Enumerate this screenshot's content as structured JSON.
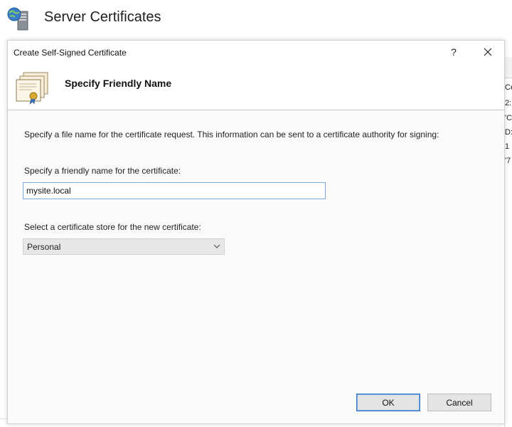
{
  "background": {
    "title": "Server Certificates",
    "icon": "server-globe-icon",
    "list_fragments": [
      "Ce",
      "2:",
      "'C",
      "D:",
      "1",
      "'7"
    ]
  },
  "dialog": {
    "title": "Create Self-Signed Certificate",
    "help_label": "?",
    "close_icon": "close-icon",
    "banner_icon": "certificate-icon",
    "heading": "Specify Friendly Name",
    "description": "Specify a file name for the certificate request.  This information can be sent to a certificate authority for signing:",
    "friendly_name_label": "Specify a friendly name for the certificate:",
    "friendly_name_value": "mysite.local",
    "store_label": "Select a certificate store for the new certificate:",
    "store_selected": "Personal",
    "ok_label": "OK",
    "cancel_label": "Cancel"
  },
  "colors": {
    "accent": "#3c79c8",
    "input_border": "#7aa7d9",
    "button_face": "#e4e4e4"
  }
}
